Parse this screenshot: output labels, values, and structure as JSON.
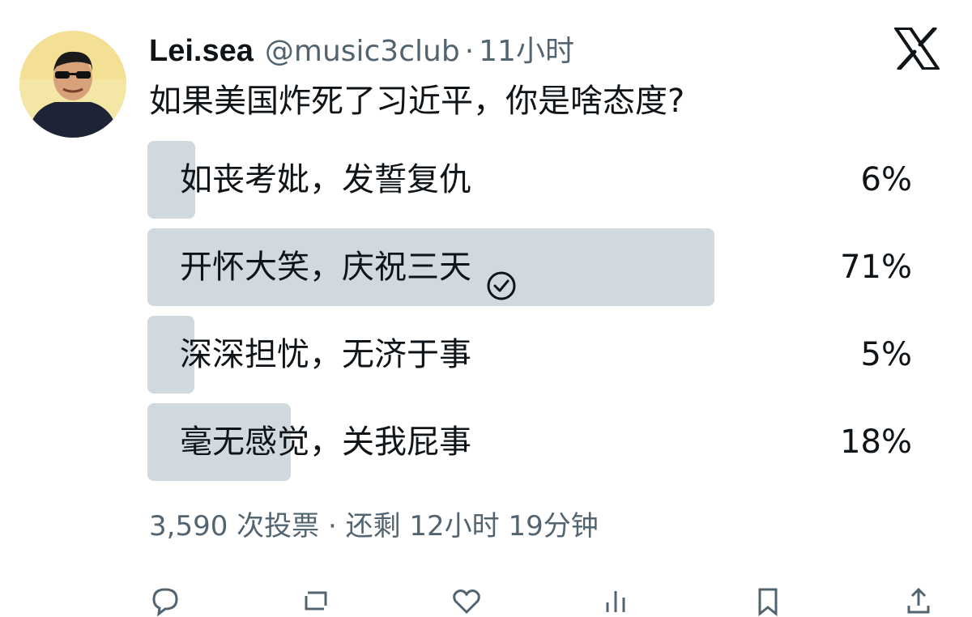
{
  "author": {
    "display_name": "Lei.sea",
    "handle": "@music3club",
    "separator": "·",
    "time_ago": "11小时"
  },
  "brand": {
    "logo_icon": "x-logo-icon"
  },
  "tweet": {
    "text": "如果美国炸死了习近平，你是啥态度?"
  },
  "poll": {
    "options": [
      {
        "label": "如丧考妣，发誓复仇",
        "percent": "6%",
        "fraction": 0.06,
        "voted": false
      },
      {
        "label": "开怀大笑，庆祝三天",
        "percent": "71%",
        "fraction": 0.71,
        "voted": true
      },
      {
        "label": "深深担忧，无济于事",
        "percent": "5%",
        "fraction": 0.05,
        "voted": false
      },
      {
        "label": "毫无感觉，关我屁事",
        "percent": "18%",
        "fraction": 0.18,
        "voted": false
      }
    ],
    "votes": "3,590 次投票",
    "separator": "·",
    "time_left": "还剩 12小时 19分钟"
  },
  "colors": {
    "bar": "#cfd9de",
    "text": "#0f1419",
    "secondary": "#536471"
  }
}
